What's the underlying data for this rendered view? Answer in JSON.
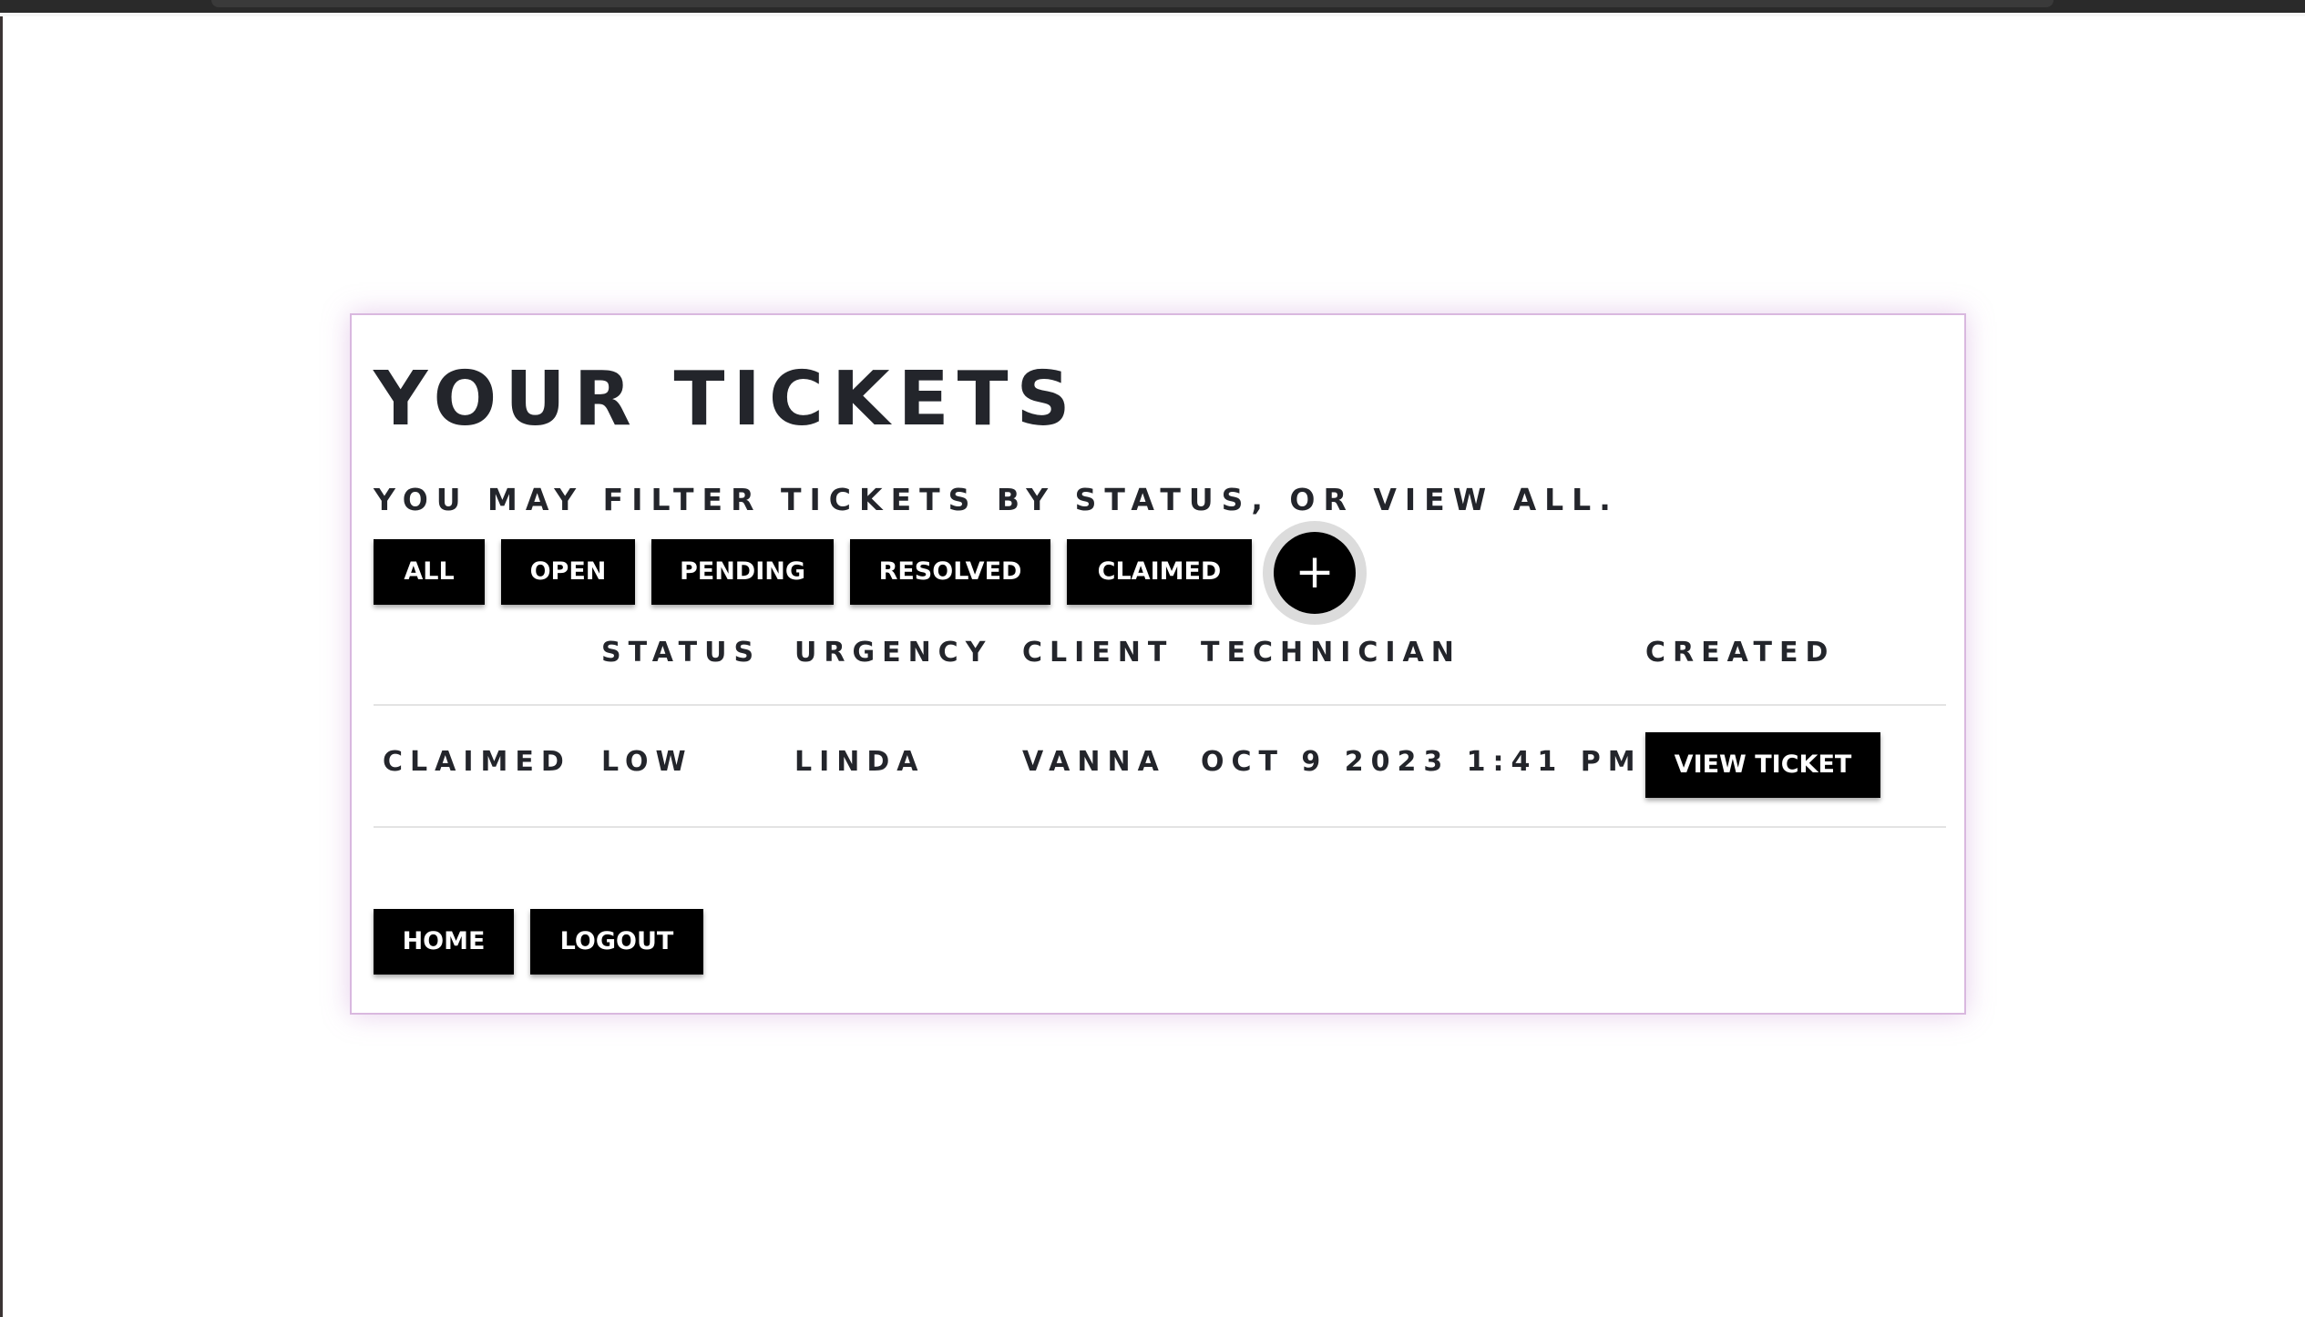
{
  "page": {
    "title": "YOUR TICKETS",
    "subtitle": "YOU MAY FILTER TICKETS BY STATUS, OR VIEW ALL."
  },
  "filters": {
    "all": "ALL",
    "open": "OPEN",
    "pending": "PENDING",
    "resolved": "RESOLVED",
    "claimed": "CLAIMED",
    "add": "+"
  },
  "table": {
    "headers": [
      "",
      "STATUS",
      "URGENCY",
      "CLIENT",
      "TECHNICIAN",
      "CREATED"
    ],
    "rows": [
      {
        "status": "CLAIMED",
        "urgency": "LOW",
        "client": "LINDA",
        "technician": "VANNA",
        "created": "OCT 9 2023 1:41 PM",
        "action": "VIEW TICKET"
      }
    ]
  },
  "footer": {
    "home": "HOME",
    "logout": "LOGOUT"
  },
  "colors": {
    "button_bg": "#000000",
    "button_text": "#ffffff",
    "text": "#23252b",
    "card_border": "#d9b8df",
    "plus_ring": "#dcdcdc"
  },
  "icons": {
    "add": "plus-icon"
  }
}
